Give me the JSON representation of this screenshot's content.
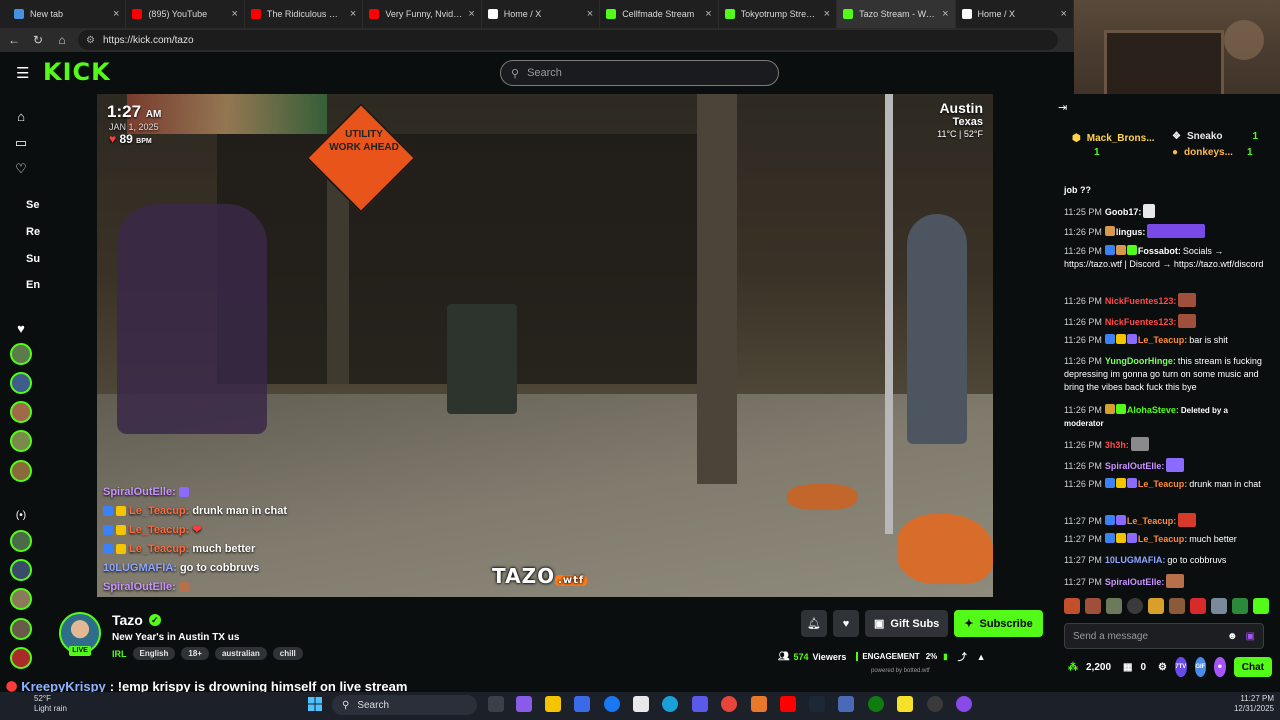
{
  "browser": {
    "tabs": [
      {
        "label": "New tab",
        "color": "#4a90e2"
      },
      {
        "label": "(895) YouTube",
        "color": "#ff0000"
      },
      {
        "label": "The Ridiculous Engineer",
        "color": "#ff0000"
      },
      {
        "label": "Very Funny, Nvidia... - Yo",
        "color": "#ff0000"
      },
      {
        "label": "Home / X",
        "color": "#ffffff"
      },
      {
        "label": "Cellfmade Stream",
        "color": "#53fc18"
      },
      {
        "label": "Tokyotrump Stream",
        "color": "#53fc18"
      },
      {
        "label": "Tazo Stream - Watc",
        "color": "#53fc18"
      },
      {
        "label": "Home / X",
        "color": "#ffffff"
      }
    ],
    "url": "https://kick.com/tazo"
  },
  "kick": {
    "search_placeholder": "Search",
    "sidebar_letters": [
      "Se",
      "Re",
      "Su",
      "En"
    ]
  },
  "video": {
    "time": "1:27",
    "ampm": "AM",
    "date": "JAN 1, 2025",
    "bpm": "89",
    "bpm_unit": "BPM",
    "city": "Austin",
    "state": "Texas",
    "temp": "11°C | 52°F",
    "sign_text": "UTILITY WORK AHEAD",
    "watermark": "TAZO",
    "watermark_suffix": ".wtf",
    "chat": [
      {
        "user": "SpiralOutElle:",
        "text": "",
        "color": "u"
      },
      {
        "user": "Le_Teacup:",
        "text": "drunk man in chat",
        "color": "u2"
      },
      {
        "user": "Le_Teacup:",
        "text": "",
        "color": "u2"
      },
      {
        "user": "Le_Teacup:",
        "text": "much better",
        "color": "u2"
      },
      {
        "user": "10LUGMAFIA:",
        "text": "go to cobbruvs",
        "color": "u3"
      },
      {
        "user": "SpiralOutElle:",
        "text": "",
        "color": "u"
      }
    ]
  },
  "channel": {
    "name": "Tazo",
    "live": "LIVE",
    "title": "New Year's in Austin TX us",
    "category": "IRL",
    "tags": [
      "English",
      "18+",
      "australian",
      "chill"
    ],
    "gift_label": "Gift Subs",
    "subscribe_label": "Subscribe",
    "viewers": "574",
    "viewers_label": "Viewers",
    "engagement_label": "ENGAGEMENT",
    "engagement_pct": "2%",
    "powered_by": "powered by botted.wtf"
  },
  "chat": {
    "leaders": [
      {
        "name": "Mack_Brons...",
        "count": "1",
        "color": "#ffd54a"
      },
      {
        "name": "Sneako",
        "count": "1",
        "color": "#ffffff"
      },
      {
        "name": "donkeys...",
        "count": "1",
        "color": "#ffb84a"
      }
    ],
    "truncated": "job ??",
    "messages": [
      {
        "time": "11:25 PM",
        "user": "Goob17:",
        "color": "#ffffff",
        "text": ""
      },
      {
        "time": "11:26 PM",
        "user": "lingus:",
        "color": "#ffffff",
        "text": ""
      },
      {
        "time": "11:26 PM",
        "user": "Fossabot:",
        "color": "#ffffff",
        "text": "Socials → https://tazo.wtf | Discord → https://tazo.wtf/discord"
      },
      {
        "time": "11:26 PM",
        "user": "NickFuentes123:",
        "color": "#ff4a4a",
        "text": ""
      },
      {
        "time": "11:26 PM",
        "user": "NickFuentes123:",
        "color": "#ff4a4a",
        "text": ""
      },
      {
        "time": "11:26 PM",
        "user": "Le_Teacup:",
        "color": "#ff8a3d",
        "text": "bar is shit"
      },
      {
        "time": "11:26 PM",
        "user": "YungDoorHinge:",
        "color": "#7cff5a",
        "text": "this stream is fucking depressing im gonna go turn on some music and bring the vibes back fuck this bye"
      },
      {
        "time": "11:26 PM",
        "user": "AlohaSteve:",
        "color": "#53fc18",
        "text": "Deleted by a moderator"
      },
      {
        "time": "11:26 PM",
        "user": "3h3h:",
        "color": "#ff4a4a",
        "text": ""
      },
      {
        "time": "11:26 PM",
        "user": "SpiralOutElle:",
        "color": "#c893ff",
        "text": ""
      },
      {
        "time": "11:26 PM",
        "user": "Le_Teacup:",
        "color": "#ff8a3d",
        "text": "drunk man in chat"
      },
      {
        "time": "11:27 PM",
        "user": "Le_Teacup:",
        "color": "#ff8a3d",
        "text": ""
      },
      {
        "time": "11:27 PM",
        "user": "Le_Teacup:",
        "color": "#ff8a3d",
        "text": "much better"
      },
      {
        "time": "11:27 PM",
        "user": "10LUGMAFIA:",
        "color": "#8fa6ff",
        "text": "go to cobbruvs"
      },
      {
        "time": "11:27 PM",
        "user": "SpiralOutElle:",
        "color": "#c893ff",
        "text": ""
      }
    ],
    "input_placeholder": "Send a message",
    "points": "2,200",
    "second_count": "0",
    "chat_button": "Chat",
    "btn_7tv": "7TV",
    "btn_gif": "GIF"
  },
  "ticker": {
    "user": "KreepyKrispy",
    "text": ": !emp krispy is drowning himself on live stream"
  },
  "taskbar": {
    "temp": "52°F",
    "weather": "Light rain",
    "search": "Search",
    "time": "11:27 PM",
    "date": "12/31/2025"
  }
}
